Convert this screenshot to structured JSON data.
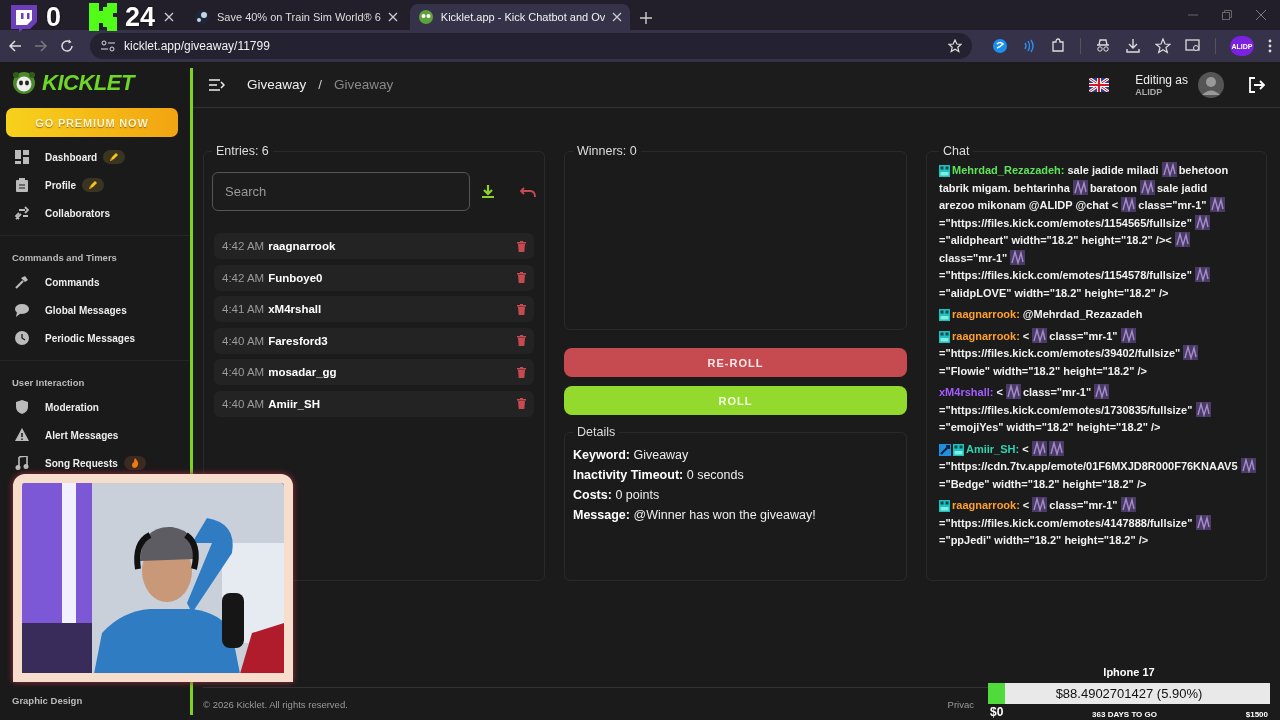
{
  "browser": {
    "tabs": [
      {
        "selected": false
      },
      {
        "title": "Save 40% on Train Sim World® 6",
        "selected": false
      },
      {
        "title": "Kicklet.app - Kick Chatbot and Ov",
        "selected": true
      }
    ],
    "address": "kicklet.app/giveaway/11799",
    "profile": "ALIDP"
  },
  "sidebar": {
    "logo": "KICKLET",
    "premium": "GO PREMIUM NOW",
    "sections": [
      {
        "items": [
          {
            "label": "Dashboard",
            "badge": {
              "kind": "premium"
            }
          },
          {
            "label": "Profile",
            "badge": {
              "kind": "premium"
            }
          },
          {
            "label": "Collaborators"
          }
        ]
      },
      {
        "title": "Commands and Timers",
        "items": [
          {
            "label": "Commands"
          },
          {
            "label": "Global Messages"
          },
          {
            "label": "Periodic Messages"
          }
        ]
      },
      {
        "title": "User Interaction",
        "items": [
          {
            "label": "Moderation"
          },
          {
            "label": "Alert Messages"
          },
          {
            "label": "Song Requests",
            "badge": {
              "kind": "hot"
            }
          }
        ]
      }
    ],
    "bottom_section": "Graphic Design"
  },
  "header": {
    "breadcrumb": [
      {
        "label": "Giveaway",
        "current": false
      },
      {
        "label": "Giveaway",
        "current": true
      }
    ],
    "separator": "/",
    "user": {
      "caption": "Editing as",
      "name": "ALIDP"
    }
  },
  "entries": {
    "title": "Entries: 6",
    "search_placeholder": "Search",
    "items": [
      {
        "time": "4:42 AM",
        "name": "raagnarrook"
      },
      {
        "time": "4:42 AM",
        "name": "Funboye0"
      },
      {
        "time": "4:41 AM",
        "name": "xM4rshall"
      },
      {
        "time": "4:40 AM",
        "name": "Faresford3"
      },
      {
        "time": "4:40 AM",
        "name": "mosadar_gg"
      },
      {
        "time": "4:40 AM",
        "name": "Amiir_SH"
      }
    ]
  },
  "winners": {
    "title": "Winners: 0"
  },
  "actions": [
    {
      "label": "RE-ROLL",
      "kind": "danger"
    },
    {
      "label": "ROLL",
      "kind": "primary"
    }
  ],
  "details": {
    "title": "Details",
    "rows": [
      {
        "label": "Keyword:",
        "value": "Giveaway"
      },
      {
        "label": "Inactivity Timeout:",
        "value": "0 seconds"
      },
      {
        "label": "Costs:",
        "value": "0 points"
      },
      {
        "label": "Message:",
        "value": "@Winner has won the giveaway!"
      }
    ]
  },
  "chat": {
    "title": "Chat",
    "messages": [
      {
        "user": "Mehrdad_Rezazadeh:",
        "color": "#5fe35a",
        "badges": [
          {
            "kind": "sub"
          }
        ],
        "parts": [
          {
            "kind": "text",
            "text": "sale jadide miladi"
          },
          {
            "kind": "emote"
          },
          {
            "kind": "text",
            "text": "behetoon"
          },
          {
            "kind": "text",
            "text": "tabrik migam. behtarinha"
          },
          {
            "kind": "emote"
          },
          {
            "kind": "text",
            "text": "baratoon"
          },
          {
            "kind": "emote"
          },
          {
            "kind": "text",
            "text": "sale jadid"
          },
          {
            "kind": "text",
            "text": "arezoo mikonam @ALIDP @chat <"
          },
          {
            "kind": "emote"
          },
          {
            "kind": "text",
            "text": "class=\"mr-1\""
          },
          {
            "kind": "emote"
          },
          {
            "kind": "text",
            "text": "=\"https://files.kick.com/emotes/1154565/fullsize\""
          },
          {
            "kind": "emote"
          },
          {
            "kind": "text",
            "text": "=\"alidpheart\" width=\"18.2\" height=\"18.2\" /><"
          },
          {
            "kind": "emote"
          },
          {
            "kind": "text",
            "text": "class=\"mr-1\""
          },
          {
            "kind": "emote"
          },
          {
            "kind": "text",
            "text": "=\"https://files.kick.com/emotes/1154578/fullsize\""
          },
          {
            "kind": "emote"
          },
          {
            "kind": "text",
            "text": "=\"alidpLOVE\" width=\"18.2\" height=\"18.2\" />"
          }
        ]
      },
      {
        "user": "raagnarrook:",
        "color": "#ff9f2e",
        "badges": [
          {
            "kind": "sub"
          }
        ],
        "parts": [
          {
            "kind": "text",
            "text": "@Mehrdad_Rezazadeh"
          }
        ]
      },
      {
        "user": "raagnarrook:",
        "color": "#ff9f2e",
        "badges": [
          {
            "kind": "sub"
          }
        ],
        "parts": [
          {
            "kind": "text",
            "text": "<"
          },
          {
            "kind": "emote"
          },
          {
            "kind": "text",
            "text": "class=\"mr-1\""
          },
          {
            "kind": "emote"
          },
          {
            "kind": "text",
            "text": "=\"https://files.kick.com/emotes/39402/fullsize\""
          },
          {
            "kind": "emote"
          },
          {
            "kind": "text",
            "text": "=\"Flowie\" width=\"18.2\" height=\"18.2\" />"
          }
        ]
      },
      {
        "user": "xM4rshall:",
        "color": "#a45cff",
        "parts": [
          {
            "kind": "text",
            "text": "<"
          },
          {
            "kind": "emote"
          },
          {
            "kind": "text",
            "text": "class=\"mr-1\""
          },
          {
            "kind": "emote"
          },
          {
            "kind": "text",
            "text": "=\"https://files.kick.com/emotes/1730835/fullsize\""
          },
          {
            "kind": "emote"
          },
          {
            "kind": "text",
            "text": "=\"emojiYes\" width=\"18.2\" height=\"18.2\" />"
          }
        ]
      },
      {
        "user": "Amiir_SH:",
        "color": "#2fd3b0",
        "badges": [
          {
            "kind": "mod"
          },
          {
            "kind": "sub"
          }
        ],
        "parts": [
          {
            "kind": "text",
            "text": "<"
          },
          {
            "kind": "emote"
          },
          {
            "kind": "emote"
          },
          {
            "kind": "text",
            "text": "=\"https://cdn.7tv.app/emote/01F6MXJD8R000F76KNAAV5"
          },
          {
            "kind": "emote"
          },
          {
            "kind": "text",
            "text": "=\"Bedge\" width=\"18.2\" height=\"18.2\" />"
          }
        ]
      },
      {
        "user": "raagnarrook:",
        "color": "#ff9f2e",
        "badges": [
          {
            "kind": "sub"
          }
        ],
        "parts": [
          {
            "kind": "text",
            "text": "<"
          },
          {
            "kind": "emote"
          },
          {
            "kind": "text",
            "text": "class=\"mr-1\""
          },
          {
            "kind": "emote"
          },
          {
            "kind": "text",
            "text": "=\"https://files.kick.com/emotes/4147888/fullsize\""
          },
          {
            "kind": "emote"
          },
          {
            "kind": "text",
            "text": "=\"ppJedi\" width=\"18.2\" height=\"18.2\" />"
          }
        ]
      }
    ]
  },
  "footer": {
    "copyright": "© 2026 Kicklet. All rights reserved.",
    "link": "Privac"
  },
  "overlay": {
    "counters": [
      {
        "kind": "viewers",
        "value": "0"
      },
      {
        "kind": "followers",
        "value": "24"
      }
    ],
    "goal": {
      "title": "Iphone 17",
      "reading": "$88.4902701427 (5.90%)",
      "level": 0.059,
      "start": "$0",
      "remaining": "363 DAYS TO GO",
      "target": "$1500"
    }
  }
}
